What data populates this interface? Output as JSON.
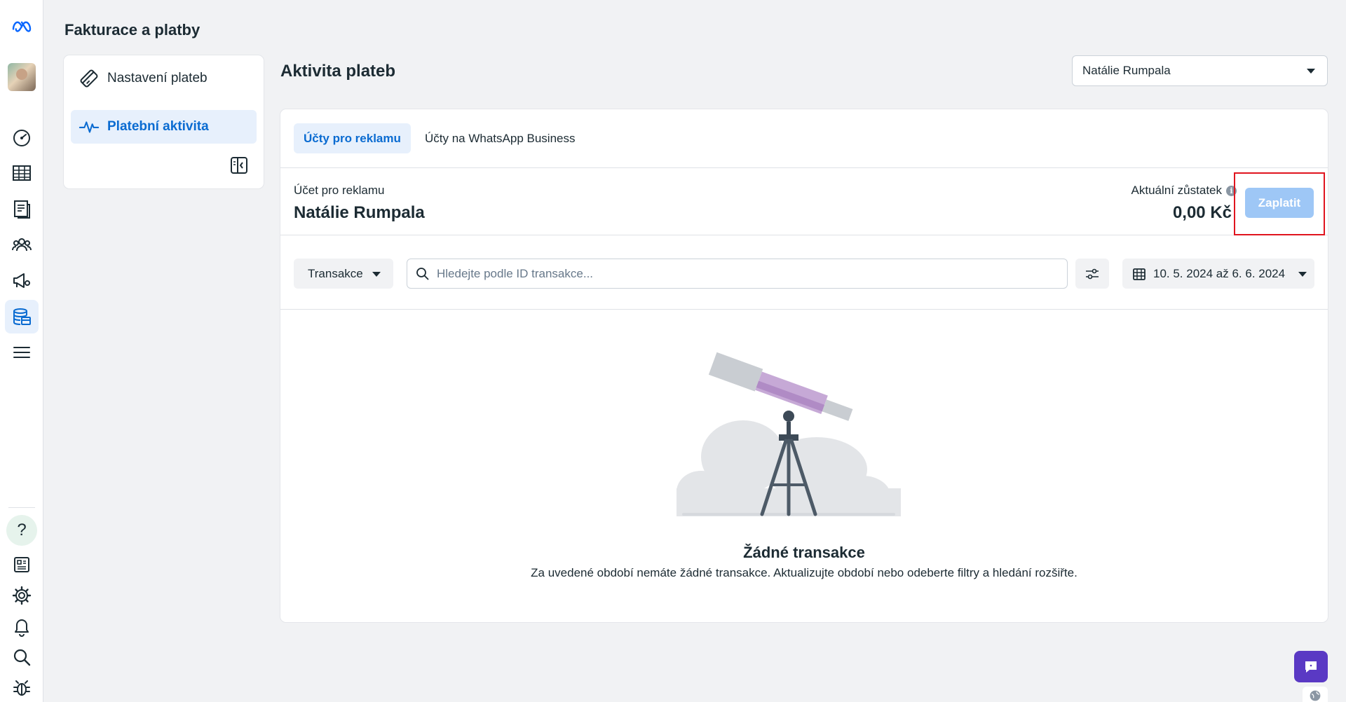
{
  "page": {
    "title": "Fakturace a platby"
  },
  "nav": {
    "items": [
      {
        "label": "Nastavení plateb",
        "icon": "card-icon",
        "active": false
      },
      {
        "label": "Platební aktivita",
        "icon": "activity-icon",
        "active": true
      }
    ]
  },
  "header": {
    "title": "Aktivita plateb",
    "account_select": "Natálie Rumpala"
  },
  "tabs": [
    {
      "label": "Účty pro reklamu",
      "active": true
    },
    {
      "label": "Účty na WhatsApp Business",
      "active": false
    }
  ],
  "account": {
    "label": "Účet pro reklamu",
    "name": "Natálie Rumpala",
    "balance_label": "Aktuální zůstatek",
    "balance_value": "0,00 Kč",
    "pay_button": "Zaplatit"
  },
  "filters": {
    "type_select": "Transakce",
    "search_placeholder": "Hledejte podle ID transakce...",
    "date_range": "10. 5. 2024 až 6. 6. 2024"
  },
  "empty_state": {
    "title": "Žádné transakce",
    "description": "Za uvedené období nemáte žádné transakce. Aktualizujte období nebo odeberte filtry a hledání rozšiřte."
  },
  "colors": {
    "accent": "#0a6bd1",
    "accent_bg": "#e7f0fc",
    "pay_disabled": "#9ec7f6",
    "highlight": "#e0141e",
    "chat": "#5a39c4"
  }
}
